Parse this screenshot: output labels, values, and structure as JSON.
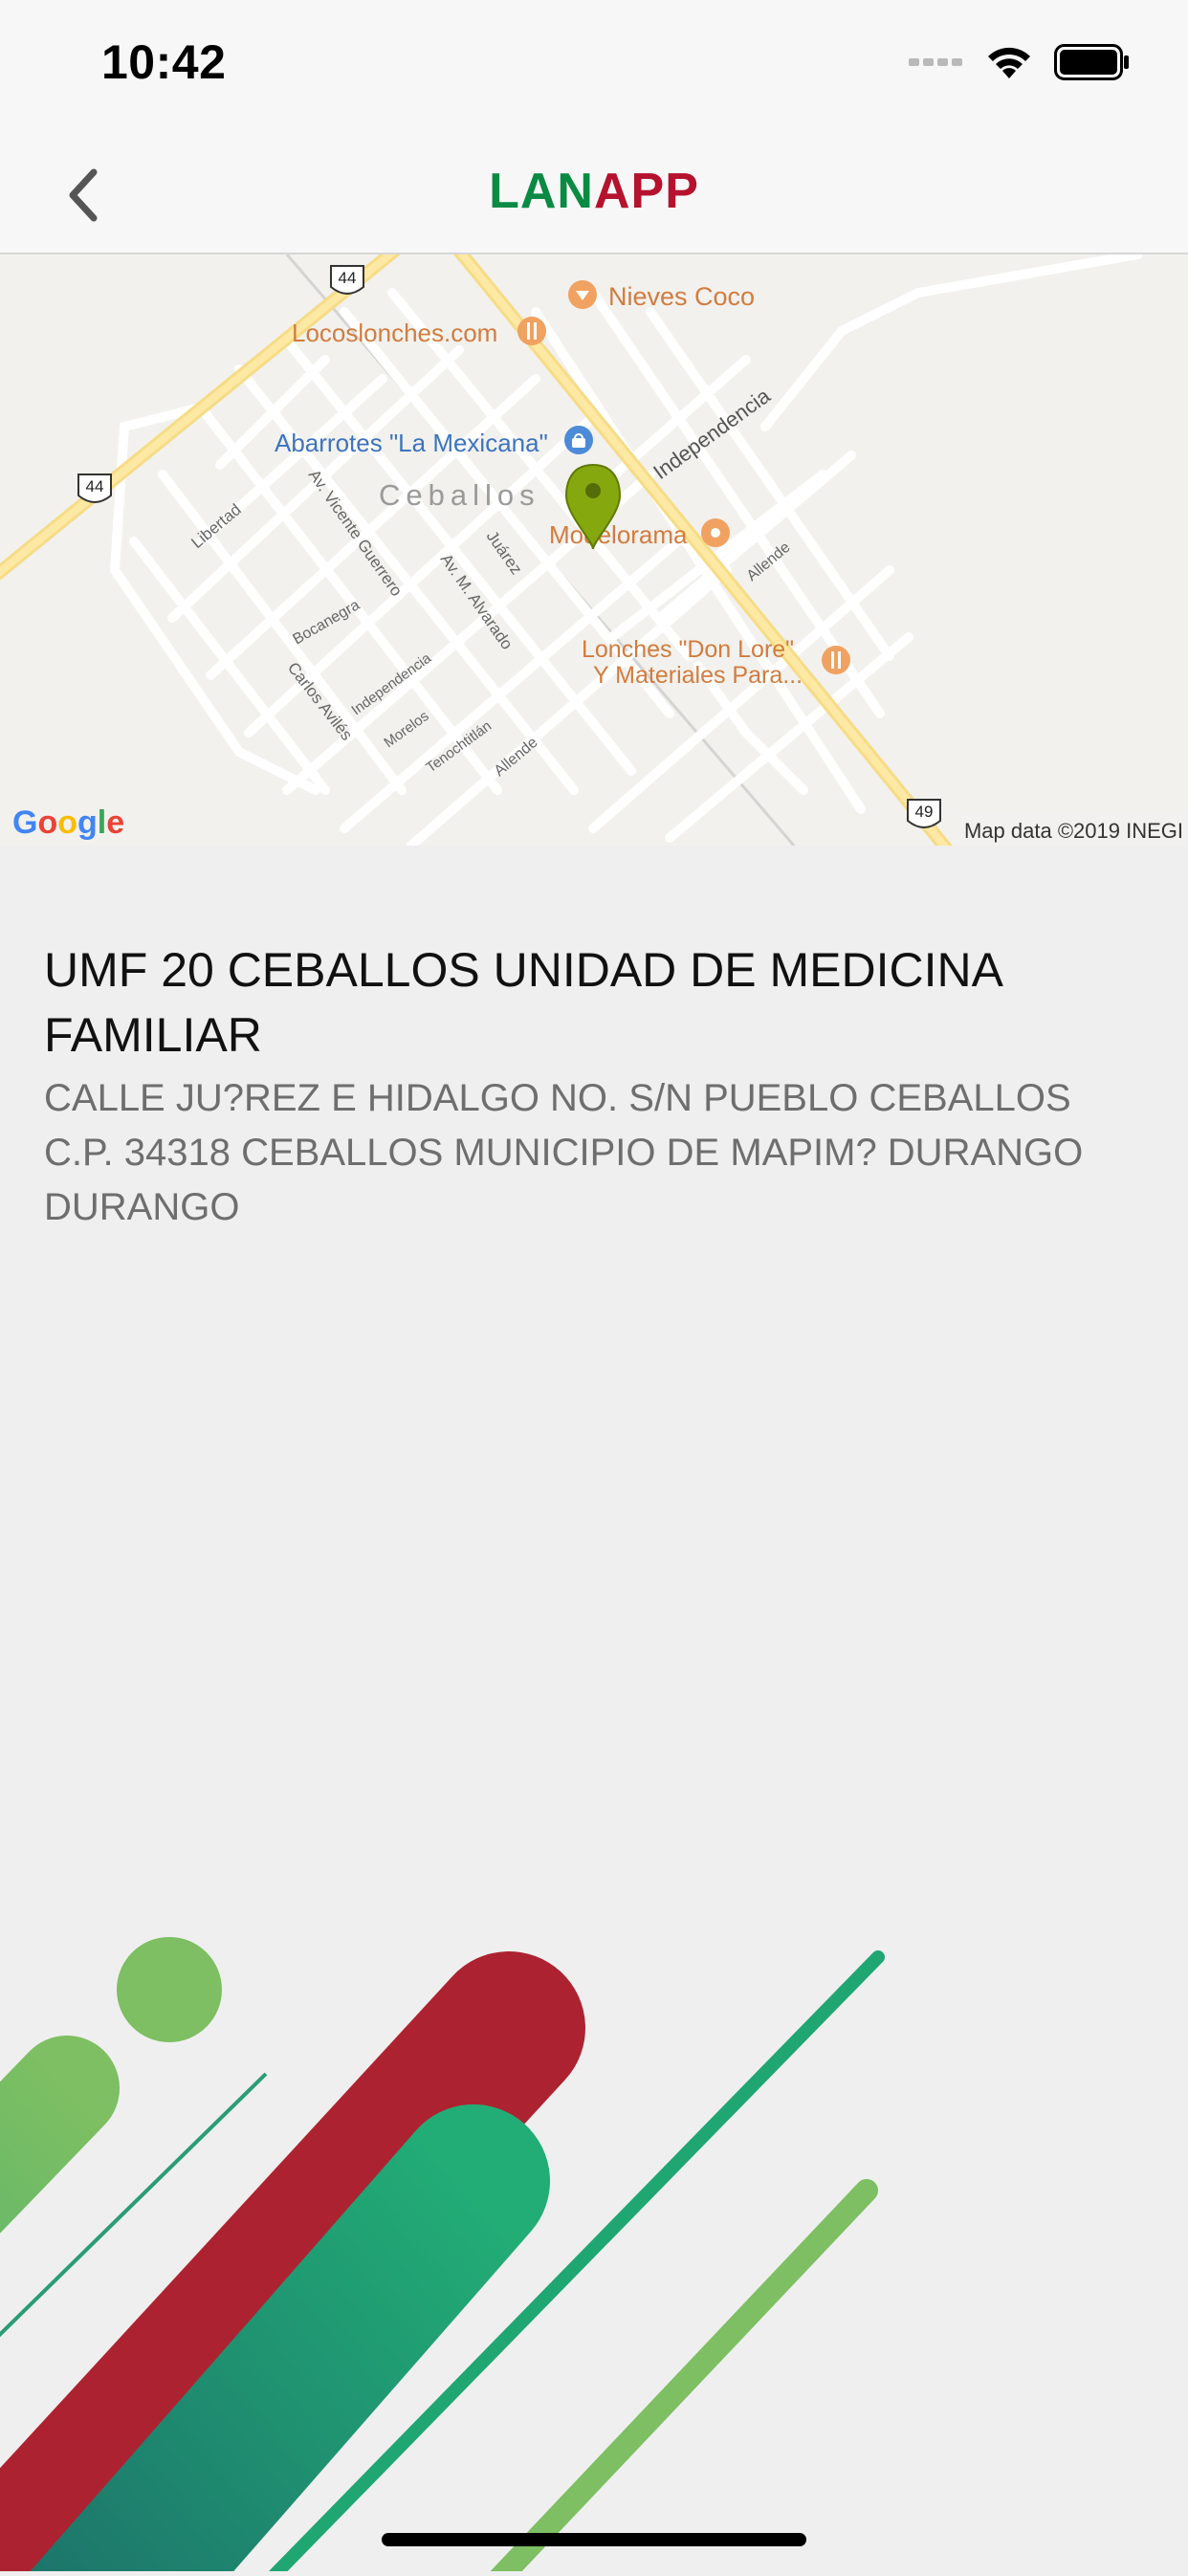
{
  "status_bar": {
    "time": "10:42",
    "signal_icon": "signal-dots-icon",
    "wifi_icon": "wifi-icon",
    "battery_icon": "battery-icon"
  },
  "nav": {
    "back_icon": "chevron-left-icon",
    "title_part1": "LAN",
    "title_part2": "APP",
    "title_colors": {
      "part1": "#0a8a43",
      "part2": "#b5122e"
    }
  },
  "map": {
    "places": {
      "nieves": "Nieves Coco",
      "locoslonches": "Locoslonches.com",
      "abarrotes": "Abarrotes \"La Mexicana\"",
      "town": "Ceballos",
      "modelorama": "Modelorama",
      "lonches_line1": "Lonches \"Don Lore\"",
      "lonches_line2": "Y Materiales Para..."
    },
    "streets": {
      "independencia_main": "Independencia",
      "libertad": "Libertad",
      "vicente_guerrero": "Av. Vicente Guerrero",
      "juarez": "Juárez",
      "alvarado": "Av. M. Alvarado",
      "allende_east": "Allende",
      "bocanegra": "Bocanegra",
      "carlos_aviles": "Carlos Avilés",
      "independencia_small": "Independencia",
      "morelos": "Morelos",
      "tenochtitlan": "Tenochtitlán",
      "allende_south": "Allende"
    },
    "highways": {
      "h44_top": "44",
      "h44_left": "44",
      "h49": "49"
    },
    "google_logo": "Google",
    "attribution": "Map data ©2019 INEGI",
    "pin_color": "#86a80f"
  },
  "unit": {
    "name": "UMF 20 CEBALLOS UNIDAD DE MEDICINA FAMILIAR",
    "address": "CALLE JU?REZ E HIDALGO NO. S/N PUEBLO CEBALLOS C.P. 34318 CEBALLOS MUNICIPIO DE MAPIM? DURANGO DURANGO"
  },
  "colors": {
    "red": "#ad2231",
    "green_dark": "#1f8a6a",
    "green_mid": "#22a877",
    "green_light": "#7dbd5e"
  }
}
